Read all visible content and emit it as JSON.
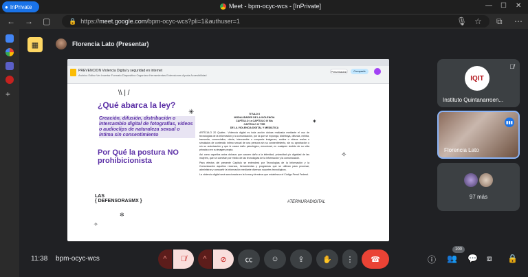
{
  "browser": {
    "inprivate_label": "InPrivate",
    "window_title": "Meet - bpm-ocyc-wcs - [InPrivate]",
    "url_scheme": "https://",
    "url_host": "meet.google.com",
    "url_path": "/bpm-ocyc-wcs?pli=1&authuser=1"
  },
  "header": {
    "presenter_label": "Florencia Lato (Presentar)"
  },
  "shared_screen": {
    "doc_title": "PREVENCION Violencia Digital y seguridad en internet",
    "doc_menus": "Archivo  Editar  Ver  Insertar  Formato  Diapositiva  Organizar  Herramientas  Extensiones  Ayuda  Accesibilidad",
    "present_label": "Presentación",
    "share_label": "Compartir",
    "slide": {
      "heading1": "¿Qué abarca la ley?",
      "body1": "Creación, difusión, distribución o intercambio digital de fotografías, videos o audioclips de naturaleza sexual o íntima sin consentimiento",
      "heading2": "Por Qué la postura NO prohibicionista",
      "logo_top": "LAS",
      "logo_bottom": "{ DEFENSORASMX }",
      "hashtag": "#TERNURADIGITAL",
      "law_headings": [
        "TITULO II",
        "MODALIDADES DE LA VIOLENCIA",
        "CAPÍTULO I a CAPÍTULO IV Bis",
        "CAPÍTULO IV TER",
        "DE LA VIOLENCIA DIGITAL Y MEDIÁTICA"
      ],
      "law_paragraphs": [
        "ARTÍCULO 20 Quáter.- Violencia digital es toda acción dolosa realizada mediante el uso de tecnologías de la información y la comunicación, por la que se exponga, distribuya, difunda, exhiba, transmita, comercialice, oferte, intercambie o comparta imágenes, audios o videos reales o simulados de contenido íntimo sexual de una persona sin su consentimiento, sin su aprobación o sin su autorización y que le cause daño psicológico, emocional, en cualquier ámbito de su vida privada o en su imagen propia.",
        "Así como aquellos actos dolosos que causen daño a la intimidad, privacidad y/o dignidad de las mujeres, que se cometan por medio de las tecnologías de la información y la comunicación.",
        "Para efectos del presente Capítulo se entenderá por Tecnologías de la Información y la Comunicación aquellos recursos, herramientas y programas que se utilizan para procesar, administrar y compartir la información mediante diversos soportes tecnológicos.",
        "La violencia digital será sancionada en la forma y términos que establezca el Código Penal Federal."
      ]
    }
  },
  "participants": [
    {
      "name": "Instituto Quintanarroen...",
      "logo_text": "IQIT",
      "muted": true
    },
    {
      "name": "Florencia Lato",
      "speaking": true
    },
    {
      "more_label": "97 más"
    }
  ],
  "bottom_bar": {
    "time": "11:38",
    "meeting_code": "bpm-ocyc-wcs",
    "people_count": "100"
  },
  "colors": {
    "accent": "#1a73e8",
    "slide_purple": "#5b2fa6",
    "end_call": "#ea4335",
    "present_badge": "#fdd663"
  }
}
